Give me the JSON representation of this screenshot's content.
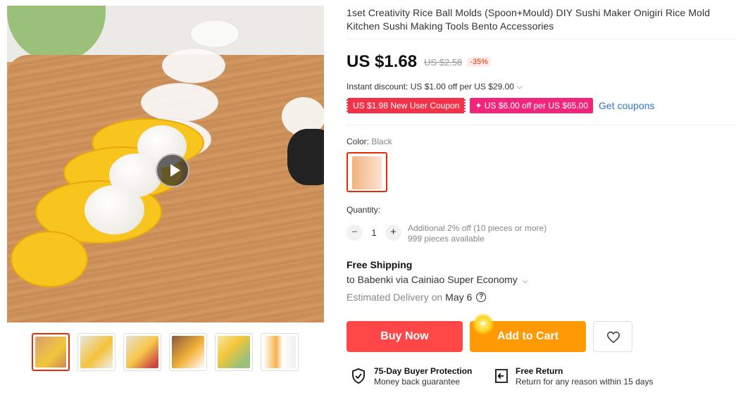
{
  "product": {
    "title": "1set Creativity Rice Ball Molds (Spoon+Mould) DIY Sushi Maker Onigiri Rice Mold Kitchen Sushi Making Tools Bento Accessories"
  },
  "pricing": {
    "price": "US $1.68",
    "original_price": "US $2.58",
    "discount": "-35%",
    "instant_discount": "Instant discount: US $1.00 off per US $29.00"
  },
  "coupons": {
    "new_user": "US $1.98 New User Coupon",
    "store": "✦ US $6.00 off per US $65.00",
    "get_coupons": "Get coupons"
  },
  "color": {
    "label": "Color: ",
    "value": "Black"
  },
  "quantity": {
    "label": "Quantity:",
    "value": "1",
    "minus": "−",
    "plus": "+",
    "additional": "Additional 2% off (10 pieces or more)",
    "available": "999 pieces available"
  },
  "shipping": {
    "title": "Free Shipping",
    "to": "to Babenki via Cainiao Super Economy",
    "estimated_label": "Estimated Delivery on",
    "date": "May 6",
    "help": "?"
  },
  "actions": {
    "buy_now": "Buy Now",
    "add_to_cart": "Add to Cart"
  },
  "assurance": [
    {
      "title": "75-Day Buyer Protection",
      "subtitle": "Money back guarantee"
    },
    {
      "title": "Free Return",
      "subtitle": "Return for any reason within 15 days"
    }
  ],
  "colors": {
    "accent_red": "#ff4747",
    "accent_orange": "#ff9a05",
    "link_blue": "#2e78c7",
    "coupon_red": "#f0324a",
    "coupon_pink": "#f0257c"
  }
}
